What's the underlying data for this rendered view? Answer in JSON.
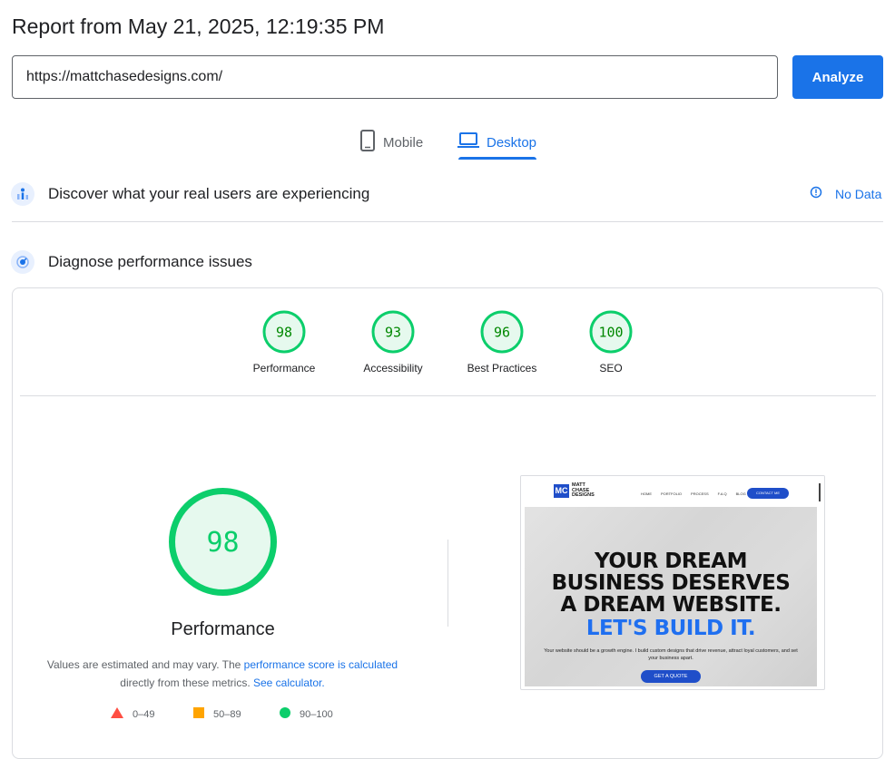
{
  "header": {
    "title": "Report from May 21, 2025, 12:19:35 PM",
    "url_value": "https://mattchasedesigns.com/",
    "analyze_label": "Analyze"
  },
  "tabs": [
    {
      "label": "Mobile",
      "icon": "phone-icon",
      "selected": false
    },
    {
      "label": "Desktop",
      "icon": "laptop-icon",
      "selected": true
    }
  ],
  "real_users": {
    "title": "Discover what your real users are experiencing",
    "status": "No Data",
    "icon": "users-chart-icon",
    "status_icon": "info-icon"
  },
  "diagnose": {
    "title": "Diagnose performance issues",
    "icon": "gauge-icon"
  },
  "scores": [
    {
      "value": "98",
      "label": "Performance"
    },
    {
      "value": "93",
      "label": "Accessibility"
    },
    {
      "value": "96",
      "label": "Best Practices"
    },
    {
      "value": "100",
      "label": "SEO"
    }
  ],
  "performance": {
    "score": "98",
    "title": "Performance",
    "note_prefix": "Values are estimated and may vary. The ",
    "note_link": "performance score is calculated",
    "note_mid": " directly from these metrics. ",
    "note_link2": "See calculator.",
    "legend": [
      {
        "shape": "triangle",
        "color": "#ff4e42",
        "range": "0–49"
      },
      {
        "shape": "square",
        "color": "#ffa400",
        "range": "50–89"
      },
      {
        "shape": "circle",
        "color": "#0cce6b",
        "range": "90–100"
      }
    ]
  },
  "colors": {
    "accent": "#1a73e8",
    "score_good": "#0cce6b",
    "score_good_text": "#008800",
    "score_good_fill": "#e6f9ee"
  },
  "screenshot": {
    "logo_mark": "MC",
    "logo_text": "MATT CHASE DESIGNS",
    "menu": [
      "HOME",
      "PORTFOLIO",
      "PROCESS",
      "F.A.Q",
      "BLOG"
    ],
    "contact": "CONTACT ME",
    "headline": [
      "YOUR DREAM",
      "BUSINESS DESERVES",
      "A DREAM WEBSITE."
    ],
    "headline_accent": "LET'S BUILD IT.",
    "subtext": "Your website should be a growth engine. I build custom designs that drive revenue, attract loyal customers, and set your business apart.",
    "cta": "GET A QUOTE"
  }
}
